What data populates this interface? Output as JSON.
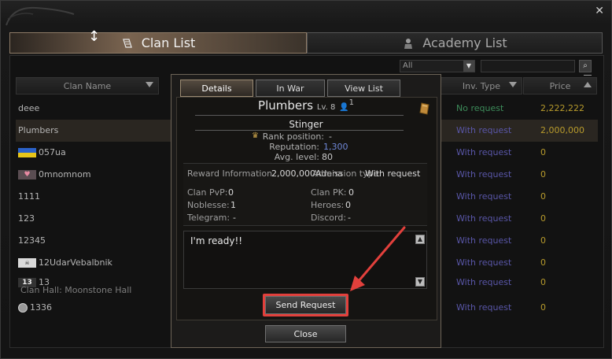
{
  "window": {
    "close_label": "✕"
  },
  "tabs": [
    {
      "label": "Clan List",
      "icon": "scroll-quill-icon"
    },
    {
      "label": "Academy List",
      "icon": "academy-icon"
    }
  ],
  "filter": {
    "selected": "All"
  },
  "columns": {
    "clan_name": "Clan Name",
    "inv_type": "Inv. Type",
    "price": "Price"
  },
  "rows": [
    {
      "name": "deee",
      "crest": "",
      "inv": "No request",
      "price": "2,222,222"
    },
    {
      "name": "Plumbers",
      "crest": "",
      "inv": "With request",
      "price": "2,000,000"
    },
    {
      "name": "057ua",
      "crest": "flag",
      "inv": "With request",
      "price": "0"
    },
    {
      "name": "0mnomnom",
      "crest": "heart",
      "inv": "With request",
      "price": "0"
    },
    {
      "name": "1111",
      "crest": "",
      "inv": "With request",
      "price": "0"
    },
    {
      "name": "123",
      "crest": "",
      "inv": "With request",
      "price": "0"
    },
    {
      "name": "12345",
      "crest": "",
      "inv": "With request",
      "price": "0"
    },
    {
      "name": "12UdarVebalbnik",
      "crest": "skull",
      "inv": "With request",
      "price": "0"
    },
    {
      "name": "13",
      "crest": "13",
      "inv": "With request",
      "price": "0"
    },
    {
      "name": "1336",
      "crest": "round",
      "inv": "With request",
      "price": "0"
    }
  ],
  "clan_hall_note": "Clan Hall: Moonstone Hall",
  "dialog": {
    "tabs": [
      "Details",
      "In War",
      "View List"
    ],
    "clan_name": "Plumbers",
    "level_label": "Lv. 8",
    "member_count": "1",
    "leader": "Stinger",
    "stats": {
      "rank_label": "Rank position:",
      "rank_value": "-",
      "rep_label": "Reputation:",
      "rep_value": "1,300",
      "avg_label": "Avg. level:",
      "avg_value": "80"
    },
    "info": {
      "reward_label": "Reward Information",
      "reward_value": "2,000,000Adena",
      "type_label": "Admission type:",
      "type_value": "With request",
      "pvp_label": "Clan PvP:",
      "pvp_value": "0",
      "pk_label": "Clan PK:",
      "pk_value": "0",
      "noblesse_label": "Noblesse:",
      "noblesse_value": "1",
      "heroes_label": "Heroes:",
      "heroes_value": "0",
      "telegram_label": "Telegram:",
      "telegram_value": "-",
      "discord_label": "Discord:",
      "discord_value": "-"
    },
    "message": "I'm ready!!",
    "send_label": "Send Request",
    "close_label": "Close"
  }
}
